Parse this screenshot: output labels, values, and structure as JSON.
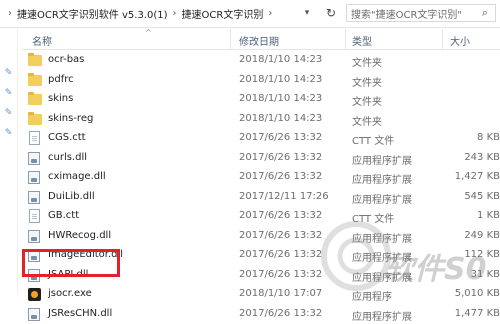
{
  "breadcrumb": [
    "捷速OCR文字识别软件 v5.3.0(1)",
    "捷速OCR文字识别"
  ],
  "search": {
    "placeholder": "搜索\"捷速OCR文字识别\""
  },
  "columns": {
    "name": "名称",
    "date": "修改日期",
    "type": "类型",
    "size": "大小"
  },
  "files": [
    {
      "name": "ocr-bas",
      "date": "2018/1/10 14:23",
      "type": "文件夹",
      "size": "",
      "icon": "folder-icon"
    },
    {
      "name": "pdfrc",
      "date": "2018/1/10 14:23",
      "type": "文件夹",
      "size": "",
      "icon": "folder-icon"
    },
    {
      "name": "skins",
      "date": "2018/1/10 14:23",
      "type": "文件夹",
      "size": "",
      "icon": "folder-icon"
    },
    {
      "name": "skins-reg",
      "date": "2018/1/10 14:23",
      "type": "文件夹",
      "size": "",
      "icon": "folder-icon"
    },
    {
      "name": "CGS.ctt",
      "date": "2017/6/26 13:32",
      "type": "CTT 文件",
      "size": "8 KB",
      "icon": "file-icon"
    },
    {
      "name": "curls.dll",
      "date": "2017/6/26 13:32",
      "type": "应用程序扩展",
      "size": "243 KB",
      "icon": "dll-icon"
    },
    {
      "name": "cximage.dll",
      "date": "2017/6/26 13:32",
      "type": "应用程序扩展",
      "size": "1,427 KB",
      "icon": "dll-icon"
    },
    {
      "name": "DuiLib.dll",
      "date": "2017/12/11 17:26",
      "type": "应用程序扩展",
      "size": "545 KB",
      "icon": "dll-icon"
    },
    {
      "name": "GB.ctt",
      "date": "2017/6/26 13:32",
      "type": "CTT 文件",
      "size": "1 KB",
      "icon": "file-icon"
    },
    {
      "name": "HWRecog.dll",
      "date": "2017/6/26 13:32",
      "type": "应用程序扩展",
      "size": "249 KB",
      "icon": "dll-icon"
    },
    {
      "name": "ImageEditor.dll",
      "date": "2017/6/26 13:32",
      "type": "应用程序扩展",
      "size": "112 KB",
      "icon": "dll-icon"
    },
    {
      "name": "JSAPI.dll",
      "date": "2017/6/26 13:32",
      "type": "应用程序扩展",
      "size": "31 KB",
      "icon": "dll-icon"
    },
    {
      "name": "jsocr.exe",
      "date": "2018/1/10 17:07",
      "type": "应用程序",
      "size": "5,010 KB",
      "icon": "exe-icon"
    },
    {
      "name": "JSResCHN.dll",
      "date": "2017/6/26 13:32",
      "type": "应用程序扩展",
      "size": "1,477 KB",
      "icon": "dll-icon"
    }
  ],
  "watermark": {
    "text": "软件S0"
  },
  "colors": {
    "highlight": "#e3202c",
    "folder": "#f3ce5a",
    "header_text": "#4c607a"
  }
}
